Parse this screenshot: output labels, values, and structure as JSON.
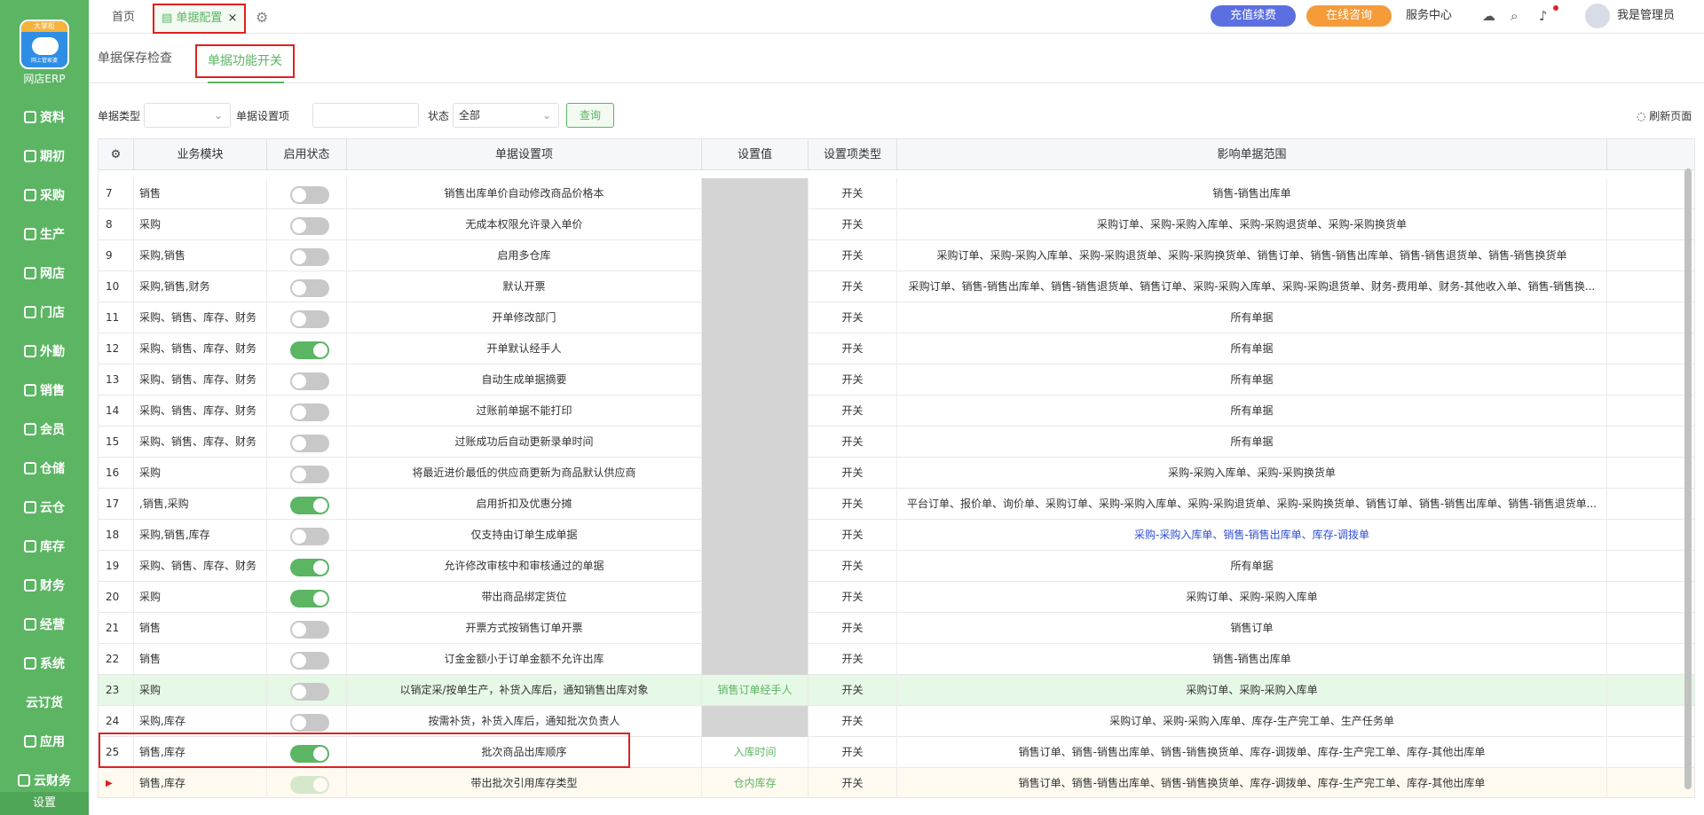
{
  "sidebar": {
    "logo_badge": "大掌柜",
    "logo_sub": "网上管家婆",
    "brand": "网店ERP",
    "items": [
      {
        "label": "资料",
        "icon": "doc-icon"
      },
      {
        "label": "期初",
        "icon": "clock-icon"
      },
      {
        "label": "采购",
        "icon": "cart-icon"
      },
      {
        "label": "生产",
        "icon": "factory-icon"
      },
      {
        "label": "网店",
        "icon": "shop-icon"
      },
      {
        "label": "门店",
        "icon": "store-icon"
      },
      {
        "label": "外勤",
        "icon": "location-icon"
      },
      {
        "label": "销售",
        "icon": "chart-icon"
      },
      {
        "label": "会员",
        "icon": "member-icon"
      },
      {
        "label": "仓储",
        "icon": "warehouse-icon"
      },
      {
        "label": "云仓",
        "icon": "cloud-warehouse-icon"
      },
      {
        "label": "库存",
        "icon": "inventory-icon"
      },
      {
        "label": "财务",
        "icon": "finance-icon"
      },
      {
        "label": "经营",
        "icon": "business-icon"
      },
      {
        "label": "系统",
        "icon": "system-icon"
      },
      {
        "label": "云订货",
        "icon": ""
      },
      {
        "label": "应用",
        "icon": "plus-icon"
      },
      {
        "label": "云财务",
        "icon": "cloud-finance-icon"
      }
    ],
    "settings": "设置"
  },
  "topbar": {
    "home": "首页",
    "active_tab": "单据配置",
    "close": "×",
    "recharge": "充值续费",
    "consult": "在线咨询",
    "service": "服务中心",
    "username": "我是管理员"
  },
  "subtabs": {
    "save_check": "单据保存检查",
    "func_switch": "单据功能开关"
  },
  "filter": {
    "type_label": "单据类型",
    "type_value": "",
    "item_label": "单据设置项",
    "item_value": "",
    "status_label": "状态",
    "status_value": "全部",
    "query": "查询",
    "refresh": "刷新页面"
  },
  "table": {
    "headers": [
      "业务模块",
      "启用状态",
      "单据设置项",
      "设置值",
      "设置项类型",
      "影响单据范围"
    ],
    "rows": [
      {
        "no": "7",
        "module": "销售",
        "on": false,
        "item": "销售出库单价自动修改商品价格本",
        "value": "",
        "gray": true,
        "type": "开关",
        "scope": "销售-销售出库单"
      },
      {
        "no": "8",
        "module": "采购",
        "on": false,
        "item": "无成本权限允许录入单价",
        "value": "",
        "gray": true,
        "type": "开关",
        "scope": "采购订单、采购-采购入库单、采购-采购退货单、采购-采购换货单"
      },
      {
        "no": "9",
        "module": "采购,销售",
        "on": false,
        "item": "启用多仓库",
        "value": "",
        "gray": true,
        "type": "开关",
        "scope": "采购订单、采购-采购入库单、采购-采购退货单、采购-采购换货单、销售订单、销售-销售出库单、销售-销售退货单、销售-销售换货单"
      },
      {
        "no": "10",
        "module": "采购,销售,财务",
        "on": false,
        "item": "默认开票",
        "value": "",
        "gray": true,
        "type": "开关",
        "scope": "采购订单、销售-销售出库单、销售-销售退货单、销售订单、采购-采购入库单、采购-采购退货单、财务-费用单、财务-其他收入单、销售-销售换..."
      },
      {
        "no": "11",
        "module": "采购、销售、库存、财务",
        "on": false,
        "item": "开单修改部门",
        "value": "",
        "gray": true,
        "type": "开关",
        "scope": "所有单据"
      },
      {
        "no": "12",
        "module": "采购、销售、库存、财务",
        "on": true,
        "item": "开单默认经手人",
        "value": "",
        "gray": true,
        "type": "开关",
        "scope": "所有单据"
      },
      {
        "no": "13",
        "module": "采购、销售、库存、财务",
        "on": false,
        "item": "自动生成单据摘要",
        "value": "",
        "gray": true,
        "type": "开关",
        "scope": "所有单据"
      },
      {
        "no": "14",
        "module": "采购、销售、库存、财务",
        "on": false,
        "item": "过账前单据不能打印",
        "value": "",
        "gray": true,
        "type": "开关",
        "scope": "所有单据"
      },
      {
        "no": "15",
        "module": "采购、销售、库存、财务",
        "on": false,
        "item": "过账成功后自动更新录单时间",
        "value": "",
        "gray": true,
        "type": "开关",
        "scope": "所有单据"
      },
      {
        "no": "16",
        "module": "采购",
        "on": false,
        "item": "将最近进价最低的供应商更新为商品默认供应商",
        "value": "",
        "gray": true,
        "type": "开关",
        "scope": "采购-采购入库单、采购-采购换货单"
      },
      {
        "no": "17",
        "module": ",销售,采购",
        "on": true,
        "item": "启用折扣及优惠分摊",
        "value": "",
        "gray": true,
        "type": "开关",
        "scope": "平台订单、报价单、询价单、采购订单、采购-采购入库单、采购-采购退货单、采购-采购换货单、销售订单、销售-销售出库单、销售-销售退货单..."
      },
      {
        "no": "18",
        "module": "采购,销售,库存",
        "on": false,
        "item": "仅支持由订单生成单据",
        "value": "",
        "gray": true,
        "type": "开关",
        "scope": "采购-采购入库单、销售-销售出库单、库存-调拨单",
        "blue": true
      },
      {
        "no": "19",
        "module": "采购、销售、库存、财务",
        "on": true,
        "item": "允许修改审核中和审核通过的单据",
        "value": "",
        "gray": true,
        "type": "开关",
        "scope": "所有单据"
      },
      {
        "no": "20",
        "module": "采购",
        "on": true,
        "item": "带出商品绑定货位",
        "value": "",
        "gray": true,
        "type": "开关",
        "scope": "采购订单、采购-采购入库单"
      },
      {
        "no": "21",
        "module": "销售",
        "on": false,
        "item": "开票方式按销售订单开票",
        "value": "",
        "gray": true,
        "type": "开关",
        "scope": "销售订单"
      },
      {
        "no": "22",
        "module": "销售",
        "on": false,
        "item": "订金金额小于订单金额不允许出库",
        "value": "",
        "gray": true,
        "type": "开关",
        "scope": "销售-销售出库单"
      },
      {
        "no": "23",
        "module": "采购",
        "on": false,
        "item": "以销定采/按单生产，补货入库后，通知销售出库对象",
        "value": "销售订单经手人",
        "gray": false,
        "type": "开关",
        "scope": "采购订单、采购-采购入库单",
        "hl": true
      },
      {
        "no": "24",
        "module": "采购,库存",
        "on": false,
        "item": "按需补货，补货入库后，通知批次负责人",
        "value": "",
        "gray": true,
        "type": "开关",
        "scope": "采购订单、采购-采购入库单、库存-生产完工单、生产任务单"
      },
      {
        "no": "25",
        "module": "销售,库存",
        "on": true,
        "item": "批次商品出库顺序",
        "value": "入库时间",
        "gray": false,
        "type": "开关",
        "scope": "销售订单、销售-销售出库单、销售-销售换货单、库存-调拨单、库存-生产完工单、库存-其他出库单"
      },
      {
        "no": "▶",
        "module": "销售,库存",
        "on": true,
        "faded": true,
        "item": "带出批次引用库存类型",
        "value": "仓内库存",
        "gray": false,
        "type": "开关",
        "scope": "销售订单、销售-销售出库单、销售-销售换货单、库存-调拨单、库存-生产完工单、库存-其他出库单",
        "cur": true
      }
    ]
  }
}
